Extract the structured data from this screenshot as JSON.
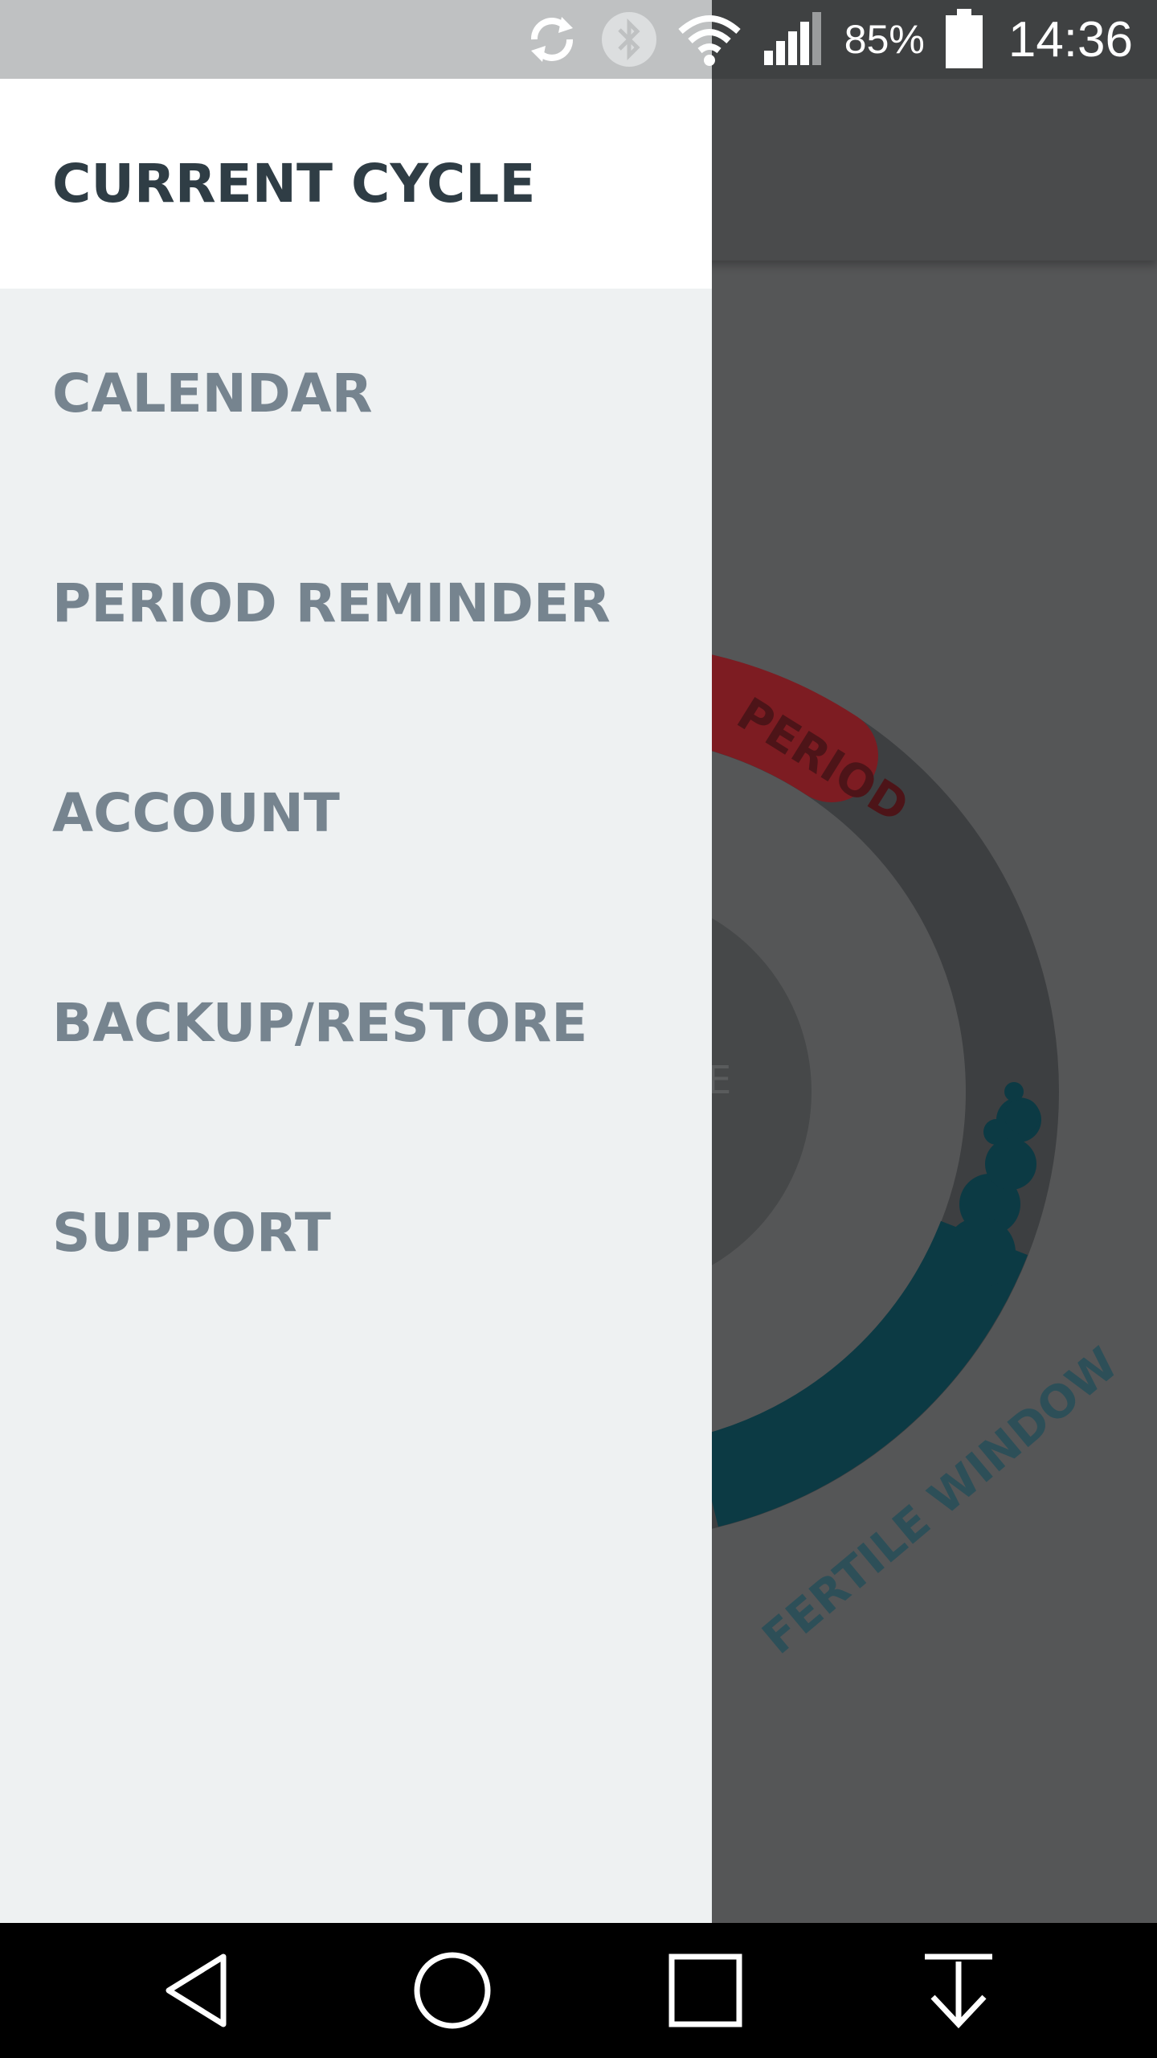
{
  "status_bar": {
    "battery_percent": "85%",
    "time": "14:36",
    "icons": [
      "sync-icon",
      "bluetooth-icon",
      "wifi-icon",
      "signal-icon",
      "battery-icon"
    ]
  },
  "background_app": {
    "ring_labels": {
      "period": "PERIOD",
      "fertile_window": "FERTILE WINDOW",
      "center_hint": "E"
    },
    "colors": {
      "period": "#7d1c22",
      "fertile": "#0c3a44",
      "ring": "#3d3f41"
    }
  },
  "drawer": {
    "items": [
      {
        "label": "CURRENT CYCLE",
        "active": true
      },
      {
        "label": "CALENDAR",
        "active": false
      },
      {
        "label": "PERIOD REMINDER",
        "active": false
      },
      {
        "label": "ACCOUNT",
        "active": false
      },
      {
        "label": "BACKUP/RESTORE",
        "active": false
      },
      {
        "label": "SUPPORT",
        "active": false
      }
    ]
  },
  "nav_bar": {
    "buttons": [
      "back-icon",
      "home-icon",
      "recents-icon",
      "notification-pull-icon"
    ]
  }
}
